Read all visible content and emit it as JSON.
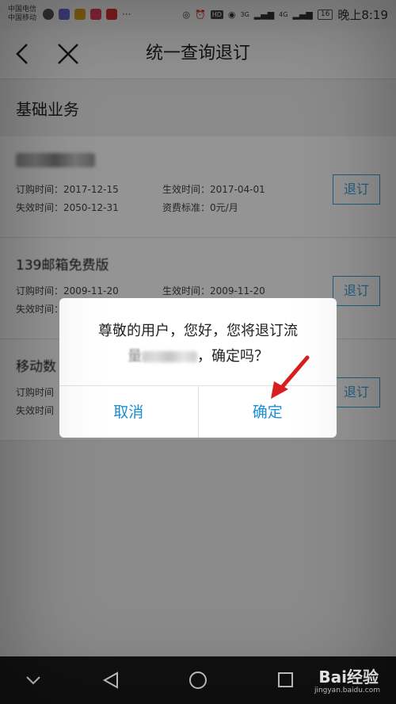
{
  "status_bar": {
    "carrier_1": "中国电信",
    "carrier_2": "中国移动",
    "signal_labels": [
      "3G",
      "4G"
    ],
    "battery": "16",
    "time": "晚上8:19"
  },
  "header": {
    "title": "统一查询退订"
  },
  "main": {
    "section_title": "基础业务",
    "services": [
      {
        "name_visible": "",
        "order_label": "订购时间：",
        "order_date": "2017-12-15",
        "effective_label": "生效时间：",
        "effective_date": "2017-04-01",
        "expire_label": "失效时间：",
        "expire_date": "2050-12-31",
        "fee_label": "资费标准：",
        "fee": "0元/月",
        "button": "退订"
      },
      {
        "name_visible": "139邮箱免费版",
        "order_label": "订购时间：",
        "order_date": "2009-11-20",
        "effective_label": "生效时间：",
        "effective_date": "2009-11-20",
        "expire_label": "失效时间：",
        "button": "退订"
      },
      {
        "name_visible": "移动数",
        "order_label": "订购时间",
        "expire_label": "失效时间",
        "button": "退订"
      }
    ]
  },
  "dialog": {
    "message_line1": "尊敬的用户，您好，您将退订流",
    "message_line2_prefix": "量",
    "message_line2_suffix": "，确定吗？",
    "cancel": "取消",
    "confirm": "确定"
  },
  "watermark": {
    "brand": "Bai经验",
    "url": "jingyan.baidu.com"
  },
  "colors": {
    "accent": "#1a8fd6",
    "arrow": "#d81e1e"
  }
}
